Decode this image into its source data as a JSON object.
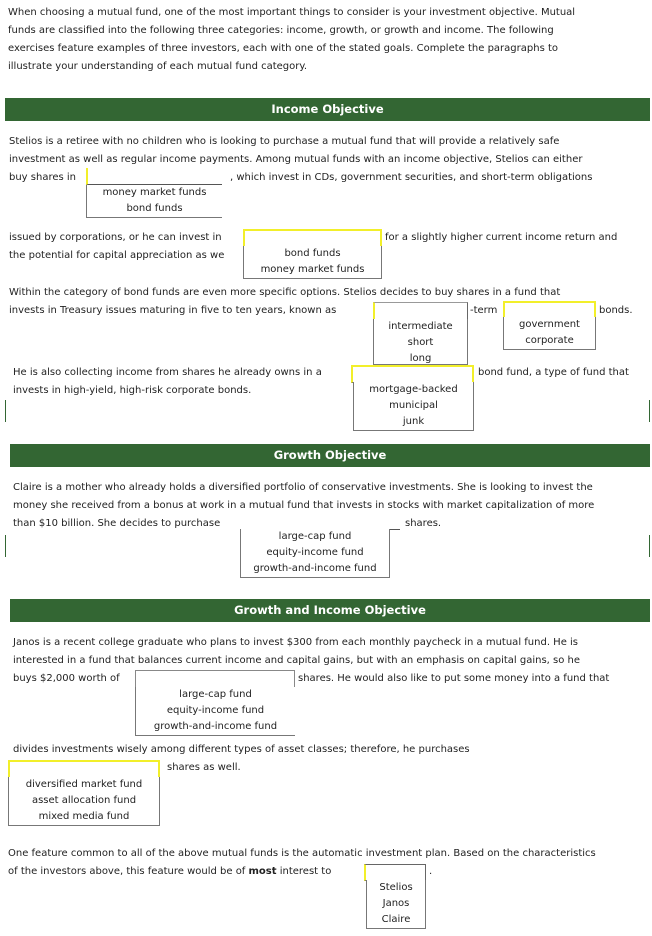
{
  "intro": [
    "When choosing a mutual fund, one of the most important things to consider is your investment objective. Mutual",
    "funds are classified into the following three categories: income, growth, or growth and income. The following",
    "exercises feature examples of three investors, each with one of the stated goals. Complete the paragraphs to",
    "illustrate your understanding of each mutual fund category."
  ],
  "income": {
    "title": "Income Objective",
    "p1_l1": "Stelios is a retiree with no children who is looking to purchase a mutual fund that will provide a relatively safe",
    "p1_l2": "investment as well as regular income payments. Among mutual funds with an income objective, Stelios can either",
    "p1_l3a": "buy shares in",
    "p1_l3b": ", which invest in CDs, government securities, and short-term obligations",
    "dd1_options": [
      "money market funds",
      "bond funds"
    ],
    "p1_l4a": "issued by corporations, or he can invest in",
    "p1_l4b": "for a slightly higher current income return and",
    "p1_l5": "the potential for capital appreciation as we",
    "dd2_options": [
      "bond funds",
      "money market funds"
    ],
    "p2_l1": "Within the category of bond funds are even more specific options. Stelios decides to buy shares in a fund that",
    "p2_l2a": "invests in Treasury issues maturing in five to ten years, known as",
    "p2_l2b": "-term",
    "p2_l2c": "bonds.",
    "dd3_options": [
      "intermediate",
      "short",
      "long"
    ],
    "dd4_options": [
      "government",
      "corporate"
    ],
    "p3_l1a": "He is also collecting income from shares he already owns in a",
    "p3_l1b": "bond fund, a type of fund that",
    "p3_l2": "invests in high-yield, high-risk corporate bonds.",
    "dd5_options": [
      "mortgage-backed",
      "municipal",
      "junk"
    ]
  },
  "growth": {
    "title": "Growth Objective",
    "l1": "Claire is a mother who already holds a diversified portfolio of conservative investments. She is looking to invest the",
    "l2": "money she received from a bonus at work in a mutual fund that invests in stocks with market capitalization of more",
    "l3a": "than $10 billion. She decides to purchase",
    "l3b": "shares.",
    "dd_options": [
      "large-cap fund",
      "equity-income fund",
      "growth-and-income fund"
    ]
  },
  "growth_income": {
    "title": "Growth and Income Objective",
    "l1": "Janos is a recent college graduate who plans to invest $300 from each monthly paycheck in a mutual fund. He is",
    "l2": "interested in a fund that balances current income and capital gains, but with an emphasis on capital gains, so he",
    "l3a": "buys $2,000 worth of",
    "l3b": "shares. He would also like to put some money into a fund that",
    "dd1_options": [
      "large-cap fund",
      "equity-income fund",
      "growth-and-income fund"
    ],
    "l4": "divides investments wisely among different types of asset classes; therefore, he purchases",
    "l5": "shares as well.",
    "dd2_options": [
      "diversified market fund",
      "asset allocation fund",
      "mixed media fund"
    ]
  },
  "final": {
    "l1": "One feature common to all of the above mutual funds is the automatic investment plan. Based on the characteristics",
    "l2a": "of the investors above, this feature would be of ",
    "l2_bold": "most",
    "l2b": " interest to",
    "l2c": ".",
    "dd_options": [
      "Stelios",
      "Janos",
      "Claire"
    ]
  },
  "colors": {
    "header": "#336633",
    "highlight": "#f2ef2a"
  }
}
